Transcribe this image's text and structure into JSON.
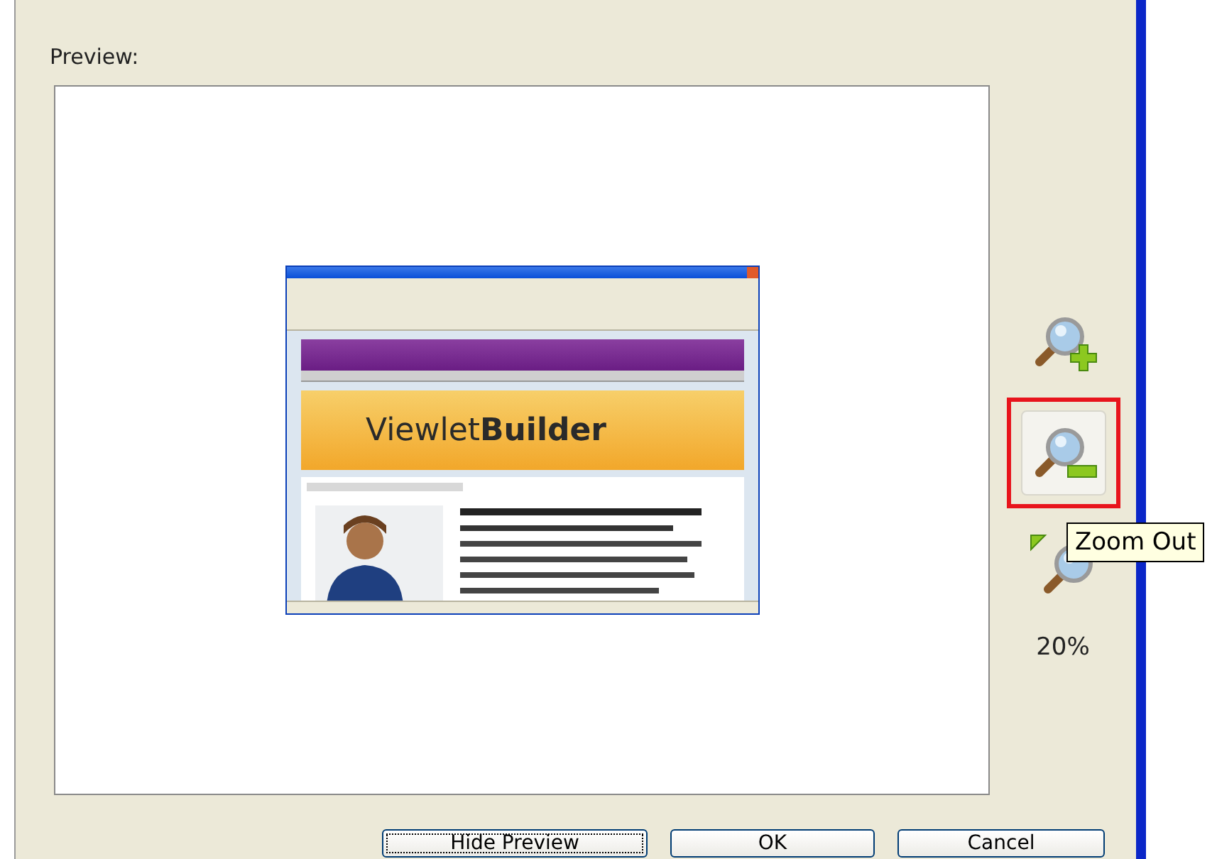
{
  "preview": {
    "label": "Preview:",
    "thumbnail": {
      "banner": "Viewlet**Builder**"
    }
  },
  "zoom_tools": [
    {
      "kind": "zoom-in",
      "selected": false
    },
    {
      "kind": "zoom-out",
      "selected": true
    },
    {
      "kind": "fit",
      "selected": false
    }
  ],
  "tooltip": "Zoom Out",
  "zoom_level": "20%",
  "buttons": [
    {
      "label": "Hide Preview",
      "focused": true
    },
    {
      "label": "OK",
      "focused": false
    },
    {
      "label": "Cancel",
      "focused": false
    }
  ]
}
